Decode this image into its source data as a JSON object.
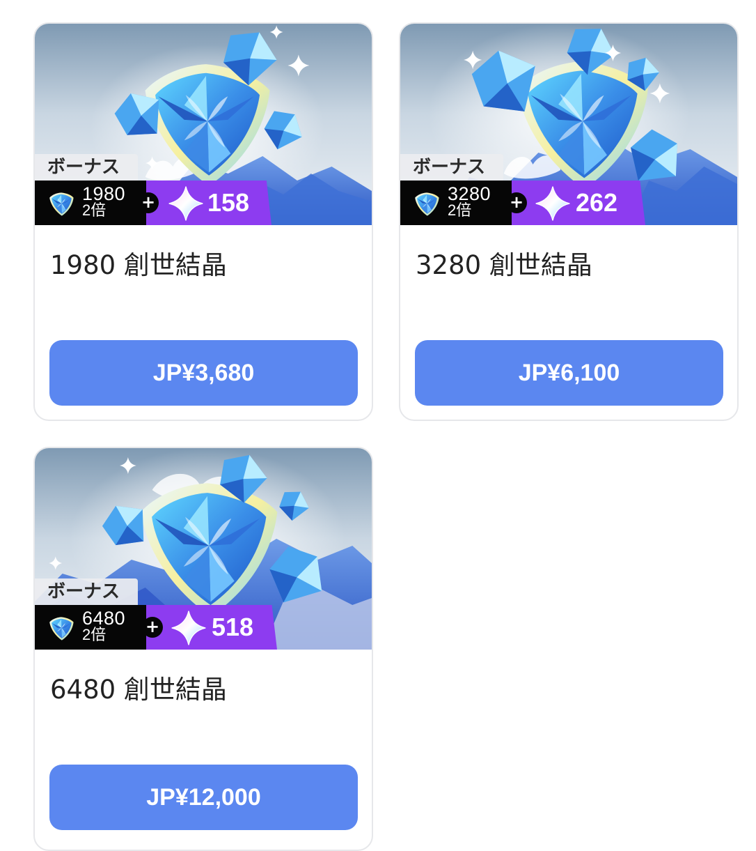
{
  "colors": {
    "card_border": "#e6e7ea",
    "button_bg": "#5b87f0",
    "bonus_black": "#060606",
    "bonus_purple": "#8d3cf0",
    "tag_bg": "#ecedf0"
  },
  "icons": {
    "crystal": "crystal-gem-icon",
    "bonus_star": "four-point-star-icon",
    "plus": "plus-icon"
  },
  "products": [
    {
      "bonus_tag": "ボーナス",
      "base_amount": "1980",
      "multiplier": "2倍",
      "plus": "+",
      "bonus_amount": "158",
      "title": "1980 創世結晶",
      "price": "JP¥3,680"
    },
    {
      "bonus_tag": "ボーナス",
      "base_amount": "3280",
      "multiplier": "2倍",
      "plus": "+",
      "bonus_amount": "262",
      "title": "3280 創世結晶",
      "price": "JP¥6,100"
    },
    {
      "bonus_tag": "ボーナス",
      "base_amount": "6480",
      "multiplier": "2倍",
      "plus": "+",
      "bonus_amount": "518",
      "title": "6480 創世結晶",
      "price": "JP¥12,000"
    }
  ]
}
